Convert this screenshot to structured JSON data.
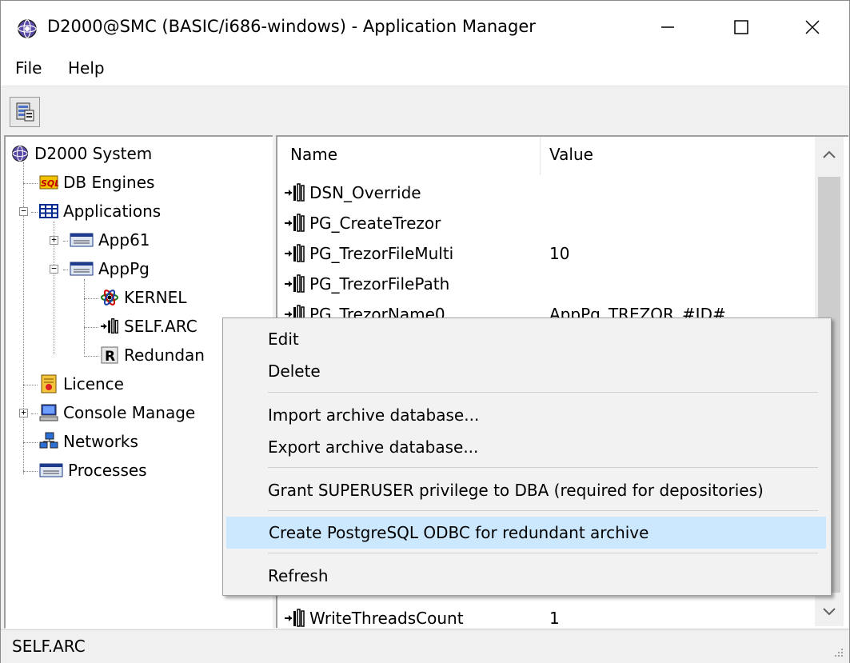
{
  "window": {
    "title": "D2000@SMC (BASIC/i686-windows) - Application Manager",
    "minimize_glyph": "—",
    "maximize_glyph": "☐",
    "close_glyph": "✕"
  },
  "menubar": {
    "items": [
      "File",
      "Help"
    ]
  },
  "tree": {
    "nodes": [
      {
        "label": "D2000 System",
        "icon": "system-globe-icon"
      },
      {
        "label": "DB Engines",
        "icon": "sql-db-icon"
      },
      {
        "label": "Applications",
        "icon": "grid-table-icon"
      },
      {
        "label": "App61",
        "icon": "app-window-icon"
      },
      {
        "label": "AppPg",
        "icon": "app-window-icon"
      },
      {
        "label": "KERNEL",
        "icon": "kernel-atom-icon"
      },
      {
        "label": "SELF.ARC",
        "icon": "archive-icon"
      },
      {
        "label": "Redundan",
        "icon": "redundant-r-icon"
      },
      {
        "label": "Licence",
        "icon": "licence-certificate-icon"
      },
      {
        "label": "Console Manage",
        "icon": "console-computer-icon"
      },
      {
        "label": "Networks",
        "icon": "network-icon"
      },
      {
        "label": "Processes",
        "icon": "process-window-icon"
      }
    ]
  },
  "list": {
    "columns": [
      "Name",
      "Value"
    ],
    "rows": [
      {
        "name": "DSN_Override",
        "value": ""
      },
      {
        "name": "PG_CreateTrezor",
        "value": ""
      },
      {
        "name": "PG_TrezorFileMulti",
        "value": "10"
      },
      {
        "name": "PG_TrezorFilePath",
        "value": ""
      },
      {
        "name": "PG_TrezorName0",
        "value": "AppPg_TREZOR_#ID#"
      },
      {
        "name": "WriteThreadsCount",
        "value": "1"
      }
    ]
  },
  "context_menu": {
    "items": [
      "Edit",
      "Delete",
      "Import archive database...",
      "Export archive database...",
      "Grant SUPERUSER privilege to DBA (required for depositories)",
      "Create PostgreSQL ODBC for redundant archive",
      "Refresh"
    ],
    "highlighted": "Create PostgreSQL ODBC for redundant archive",
    "highlight_color": "#cce8ff"
  },
  "statusbar": {
    "text": "SELF.ARC"
  },
  "scrollbar": {
    "up_glyph": "▲",
    "down_glyph": "▼"
  }
}
